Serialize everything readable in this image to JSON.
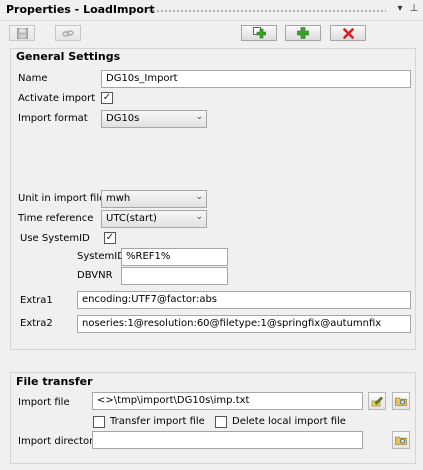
{
  "window": {
    "title": "Properties - LoadImport",
    "controls": {
      "dropdown_icon": "triangle-down",
      "pin_icon": "pin"
    }
  },
  "toolbar": {
    "buttons": [
      {
        "icon": "save-icon",
        "enabled": false
      },
      {
        "icon": "link-icon",
        "enabled": false
      },
      {
        "icon": "add-copy-icon",
        "enabled": true
      },
      {
        "icon": "add-icon",
        "enabled": true
      },
      {
        "icon": "delete-icon",
        "enabled": true
      }
    ],
    "colors": {
      "add": "#3aa42a",
      "delete": "#d32020"
    }
  },
  "general": {
    "title": "General Settings",
    "name_label": "Name",
    "name_value": "DG10s_Import",
    "activate_label": "Activate import",
    "activate_checked": true,
    "format_label": "Import format",
    "format_value": "DG10s",
    "unit_label": "Unit in import file",
    "unit_value": "mwh",
    "timeref_label": "Time reference",
    "timeref_value": "UTC(start)",
    "use_systemid_label": "Use SystemID",
    "use_systemid_checked": true,
    "systemid_label": "SystemID",
    "systemid_value": "%REF1%",
    "dbvnr_label": "DBVNR",
    "dbvnr_value": "",
    "extra1_label": "Extra1",
    "extra1_value": "encoding:UTF7@factor:abs",
    "extra2_label": "Extra2",
    "extra2_value": "noseries:1@resolution:60@filetype:1@springfix@autumnfix"
  },
  "file_transfer": {
    "title": "File transfer",
    "import_file_label": "Import file",
    "import_file_value": "<>\\tmp\\import\\DG10s\\imp.txt",
    "transfer_label": "Transfer import file",
    "transfer_checked": false,
    "delete_label": "Delete local import file",
    "delete_checked": false,
    "import_dir_label": "Import directory",
    "import_dir_value": ""
  }
}
